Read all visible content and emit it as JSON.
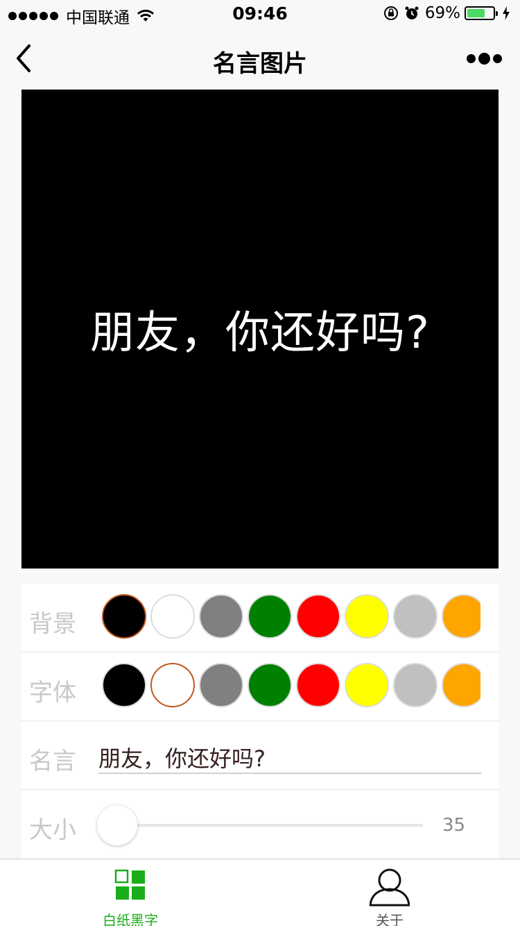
{
  "status_bar": {
    "carrier": "中国联通",
    "time": "09:46",
    "battery": "69%",
    "battery_level": 0.69
  },
  "nav": {
    "title": "名言图片"
  },
  "preview": {
    "text": "朋友，你还好吗?",
    "background": "#000000",
    "text_color": "#ffffff"
  },
  "settings": {
    "background": {
      "label": "背景",
      "selected_index": 0,
      "colors": [
        "#000000",
        "#ffffff",
        "#808080",
        "#008000",
        "#ff0000",
        "#ffff00",
        "#c0c0c0",
        "#ffa500"
      ]
    },
    "font": {
      "label": "字体",
      "selected_index": 1,
      "colors": [
        "#000000",
        "#ffffff",
        "#808080",
        "#008000",
        "#ff0000",
        "#ffff00",
        "#c0c0c0",
        "#ffa500"
      ]
    },
    "quote": {
      "label": "名言",
      "value": "朋友，你还好吗?"
    },
    "size": {
      "label": "大小",
      "value": "35"
    }
  },
  "tabbar": {
    "items": [
      {
        "label": "白纸黑字",
        "active": true,
        "icon": "grid-icon"
      },
      {
        "label": "关于",
        "active": false,
        "icon": "person-icon"
      }
    ],
    "active_color": "#1aad19"
  }
}
